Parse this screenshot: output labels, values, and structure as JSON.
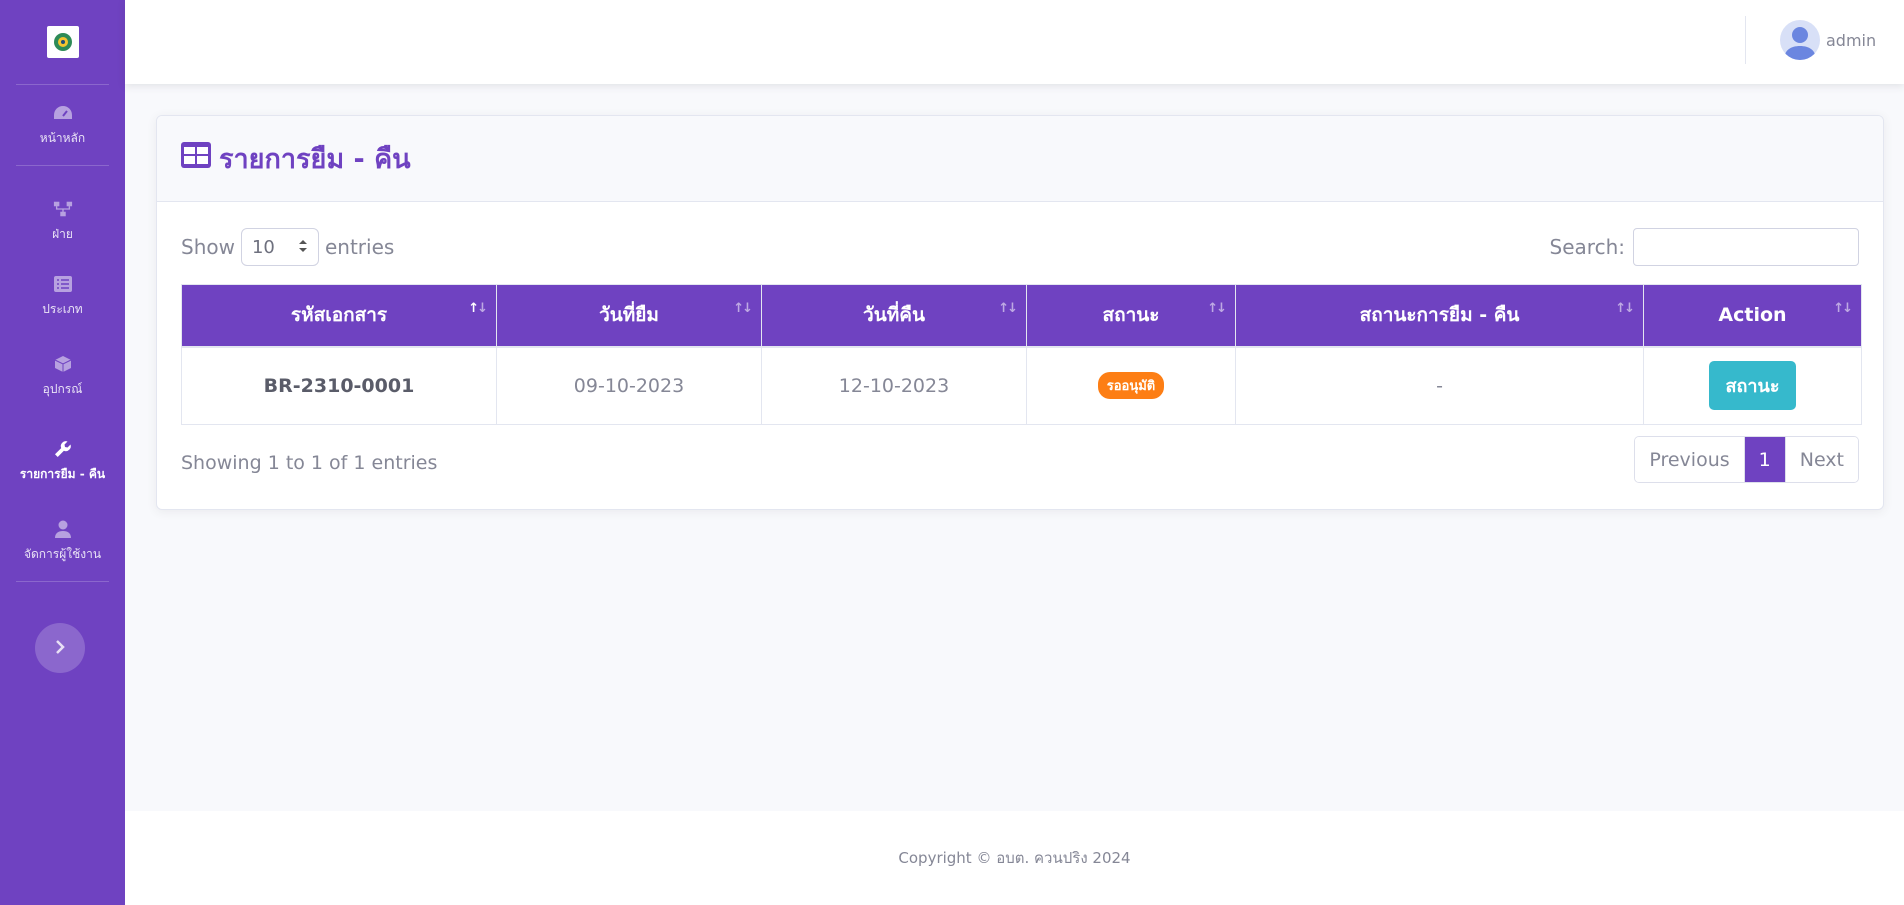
{
  "colors": {
    "primary": "#6f42c1",
    "info": "#36b9cc",
    "warning": "#fd7e14"
  },
  "sidebar": {
    "items": [
      {
        "label": "หน้าหลัก",
        "icon": "tachometer-icon"
      },
      {
        "label": "ฝ่าย",
        "icon": "sitemap-icon"
      },
      {
        "label": "ประเภท",
        "icon": "list-alt-icon"
      },
      {
        "label": "อุปกรณ์",
        "icon": "cube-icon"
      },
      {
        "label": "รายการยืม - คืน",
        "icon": "wrench-icon",
        "active": true
      },
      {
        "label": "จัดการผู้ใช้งาน",
        "icon": "user-icon"
      }
    ]
  },
  "topbar": {
    "user_name": "admin"
  },
  "card": {
    "title": "รายการยืม - คืน"
  },
  "table_controls": {
    "show_label": "Show",
    "entries_value": "10",
    "entries_label": "entries",
    "search_label": "Search:",
    "search_value": ""
  },
  "table": {
    "columns": [
      "รหัสเอกสาร",
      "วันที่ยืม",
      "วันที่คืน",
      "สถานะ",
      "สถานะการยืม - คืน",
      "Action"
    ],
    "rows": [
      {
        "doc_no": "BR-2310-0001",
        "borrow_date": "09-10-2023",
        "return_date": "12-10-2023",
        "status": "รออนุมัติ",
        "borrow_status": "-",
        "action": "สถานะ"
      }
    ]
  },
  "table_info": "Showing 1 to 1 of 1 entries",
  "pagination": {
    "previous": "Previous",
    "current": "1",
    "next": "Next"
  },
  "footer": {
    "copyright": "Copyright © อบต. ควนปริง 2024"
  }
}
